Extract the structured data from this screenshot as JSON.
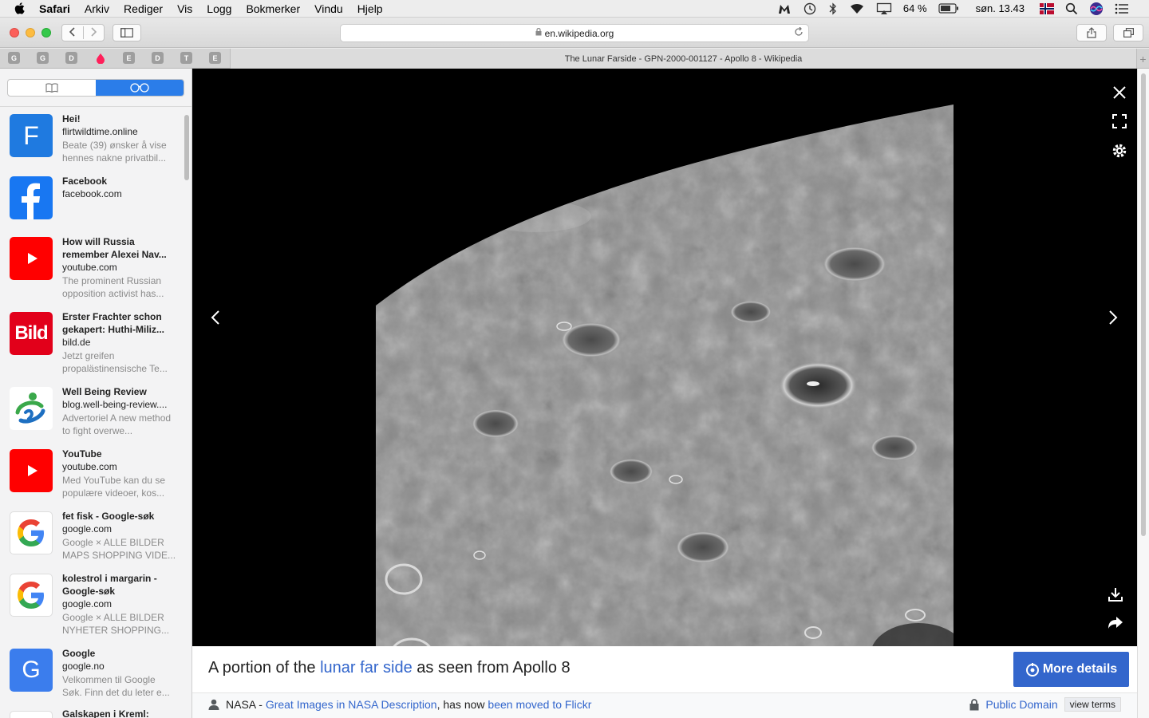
{
  "menubar": {
    "app": "Safari",
    "items": [
      "Arkiv",
      "Rediger",
      "Vis",
      "Logg",
      "Bokmerker",
      "Vindu",
      "Hjelp"
    ],
    "battery": "64 %",
    "clock": "søn. 13.43"
  },
  "toolbar": {
    "address": "en.wikipedia.org"
  },
  "tabbar": {
    "pinned": [
      "G",
      "G",
      "D",
      "",
      "E",
      "D",
      "T",
      "E"
    ],
    "title": "The Lunar Farside - GPN-2000-001127 - Apollo 8 - Wikipedia"
  },
  "reading_list": [
    {
      "title": "Hei!",
      "domain": "flirtwildtime.online",
      "desc": "Beate (39) ønsker å vise hennes nakne privatbil...",
      "thumb": "F",
      "color": "#1f7ae0"
    },
    {
      "title": "Facebook",
      "domain": "facebook.com",
      "desc": "",
      "thumb": "f",
      "color": "#1877f2"
    },
    {
      "title": "How will Russia remember Alexei Nav...",
      "domain": "youtube.com",
      "desc": "The prominent Russian opposition activist has...",
      "thumb": "yt",
      "color": "#ff0000"
    },
    {
      "title": "Erster Frachter schon gekapert: Huthi-Miliz...",
      "domain": "bild.de",
      "desc": "Jetzt greifen propalästinensische Te...",
      "thumb": "Bild",
      "color": "#e2001a"
    },
    {
      "title": "Well Being Review",
      "domain": "blog.well-being-review....",
      "desc": "Advertoriel A new method to fight overwe...",
      "thumb": "wb",
      "color": "#ffffff"
    },
    {
      "title": "YouTube",
      "domain": "youtube.com",
      "desc": "Med YouTube kan du se populære videoer, kos...",
      "thumb": "yt",
      "color": "#ff0000"
    },
    {
      "title": "fet fisk - Google-søk",
      "domain": "google.com",
      "desc": "Google × ALLE BILDER MAPS SHOPPING VIDE...",
      "thumb": "G",
      "color": "#ffffff"
    },
    {
      "title": "kolestrol i margarin - Google-søk",
      "domain": "google.com",
      "desc": "Google × ALLE BILDER NYHETER SHOPPING...",
      "thumb": "G",
      "color": "#ffffff"
    },
    {
      "title": "Google",
      "domain": "google.no",
      "desc": "Velkommen til Google Søk. Finn det du leter e...",
      "thumb": "G",
      "color": "#3b7ded"
    },
    {
      "title": "Galskapen i Kreml:",
      "domain": "",
      "desc": "",
      "thumb": "",
      "color": "#ffffff"
    }
  ],
  "viewer": {
    "caption_prefix": "A portion of the ",
    "caption_link": "lunar far side",
    "caption_suffix": " as seen from Apollo 8",
    "more_details": "More details",
    "credit_author": "NASA",
    "credit_sep": " - ",
    "credit_link1": "Great Images in NASA Description",
    "credit_mid": ", has now ",
    "credit_link2": "been moved to Flickr",
    "license": "Public Domain",
    "view_terms": "view terms"
  }
}
